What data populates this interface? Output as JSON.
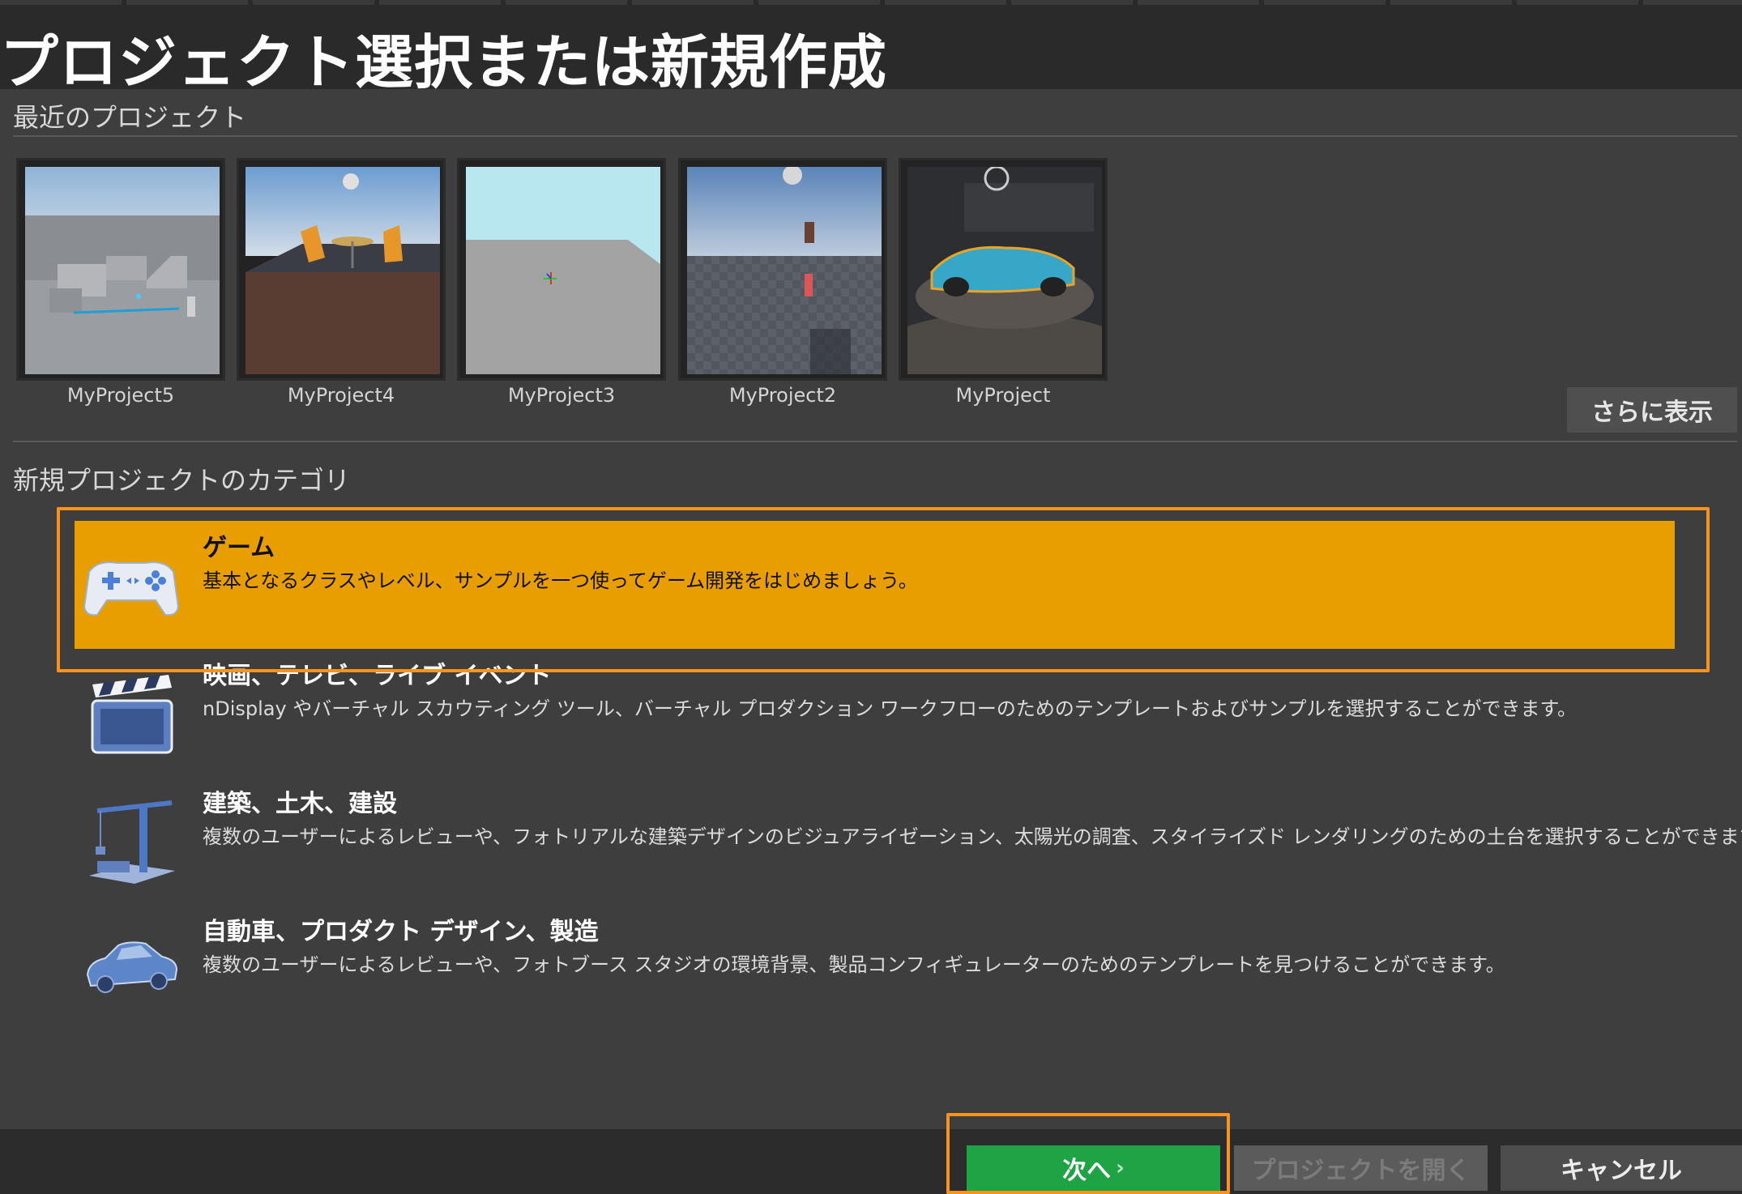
{
  "window": {
    "title": "プロジェクト選択または新規作成"
  },
  "recent": {
    "heading": "最近のプロジェクト",
    "projects": [
      {
        "name": "MyProject5"
      },
      {
        "name": "MyProject4"
      },
      {
        "name": "MyProject3"
      },
      {
        "name": "MyProject2"
      },
      {
        "name": "MyProject"
      }
    ],
    "more_label": "さらに表示"
  },
  "categories": {
    "heading": "新規プロジェクトのカテゴリ",
    "items": [
      {
        "name": "ゲーム",
        "description": "基本となるクラスやレベル、サンプルを一つ使ってゲーム開発をはじめましょう。",
        "icon": "gamepad-icon",
        "selected": true
      },
      {
        "name": "映画、テレビ、ライブ イベント",
        "description": "nDisplay やバーチャル スカウティング ツール、バーチャル プロダクション ワークフローのためのテンプレートおよびサンプルを選択することができます。",
        "icon": "clapperboard-icon",
        "selected": false
      },
      {
        "name": "建築、土木、建設",
        "description": "複数のユーザーによるレビューや、フォトリアルな建築デザインのビジュアライゼーション、太陽光の調査、スタイライズド レンダリングのための土台を選択することができます。",
        "icon": "crane-icon",
        "selected": false
      },
      {
        "name": "自動車、プロダクト デザイン、製造",
        "description": "複数のユーザーによるレビューや、フォトブース スタジオの環境背景、製品コンフィギュレーターのためのテンプレートを見つけることができます。",
        "icon": "car-icon",
        "selected": false
      }
    ]
  },
  "footer": {
    "next_label": "次へ",
    "open_label": "プロジェクトを開く",
    "cancel_label": "キャンセル"
  },
  "colors": {
    "accent": "#e89e00",
    "highlight": "#f7931e",
    "next": "#1ea345"
  }
}
